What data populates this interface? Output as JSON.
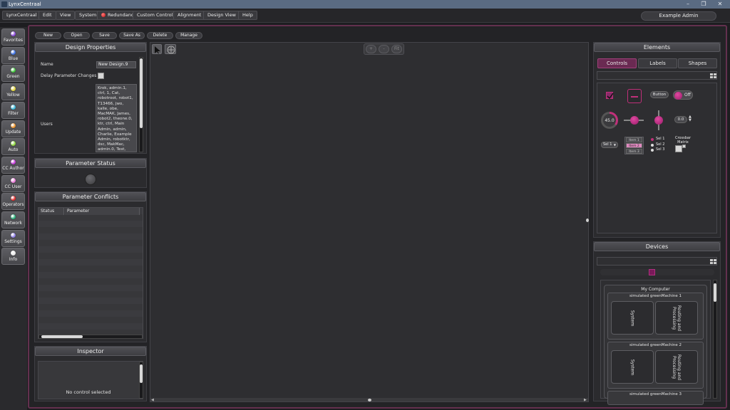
{
  "window": {
    "title": "LynxCentraal"
  },
  "menu": [
    "LynxCentraal",
    "Edit",
    "View",
    "System",
    "Redundancy",
    "Custom Control",
    "Alignment",
    "Design View",
    "Help"
  ],
  "user": "Example Admin",
  "nav": [
    {
      "label": "Favorites",
      "color": "#8a48d8"
    },
    {
      "label": "Blue",
      "color": "#3a6fe0"
    },
    {
      "label": "Green",
      "color": "#3ec43a"
    },
    {
      "label": "Yellow",
      "color": "#e0d23a"
    },
    {
      "label": "Filter",
      "color": "#3ab6d8"
    },
    {
      "label": "Update",
      "color": "#e8902a"
    },
    {
      "label": "Auto",
      "color": "#8ad23a"
    },
    {
      "label": "CC Author",
      "color": "#c43ad8"
    },
    {
      "label": "CC User",
      "color": "#e87ad8"
    },
    {
      "label": "Operators",
      "color": "#e02a2a"
    },
    {
      "label": "Network",
      "color": "#2ab07a"
    },
    {
      "label": "Settings",
      "color": "#8a7ae0"
    },
    {
      "label": "Info",
      "color": "#e8e8e8"
    }
  ],
  "toolbar": [
    "New",
    "Open",
    "Save",
    "Save As",
    "Delete",
    "Manage"
  ],
  "design_properties": {
    "title": "Design Properties",
    "name_label": "Name",
    "name_value": "New Design.9",
    "delay_label": "Delay Parameter Changes",
    "users_label": "Users",
    "users_value": "Krok, admin.1, ctrl, 1, Cat, robotroot, robot1, T13466, jwo, kalle, obe, MacMAK, James, robot2, theone.0, ktr, ctrl, Main Admin, admin, Charlie, Example Admin, robotktr, dsc, MakMac, admin.0, Test, MGO, ctrl.0"
  },
  "parameter_status": {
    "title": "Parameter Status"
  },
  "parameter_conflicts": {
    "title": "Parameter Conflicts",
    "col_status": "Status",
    "col_parameter": "Parameter"
  },
  "inspector": {
    "title": "Inspector",
    "empty_text": "No control selected"
  },
  "canvas_zoom": [
    "+",
    "-",
    "Fit"
  ],
  "elements": {
    "title": "Elements",
    "tabs": [
      "Controls",
      "Labels",
      "Shapes"
    ],
    "button_label": "Button",
    "toggle_label": "Off",
    "knob_value": "45.0",
    "spin_value": "0.0",
    "select_value": "Sel 1",
    "list_items": [
      "Item 1",
      "Item 2",
      "Item 3"
    ],
    "radio_items": [
      "Sel 1",
      "Sel 2",
      "Sel 3"
    ],
    "crossbar_label": "Crossbar\nMatrix"
  },
  "devices": {
    "title": "Devices",
    "computer": "My Computer",
    "machines": [
      {
        "name": "simulated greenMachine 1",
        "tiles": [
          "System",
          "Routing and Processing"
        ]
      },
      {
        "name": "simulated greenMachine 2",
        "tiles": [
          "System",
          "Routing and Processing"
        ]
      },
      {
        "name": "simulated greenMachine 3",
        "tiles": []
      }
    ]
  },
  "colors": {
    "accent": "#7a2a5e",
    "accent_light": "#c0307a",
    "frame": "#63304e"
  }
}
